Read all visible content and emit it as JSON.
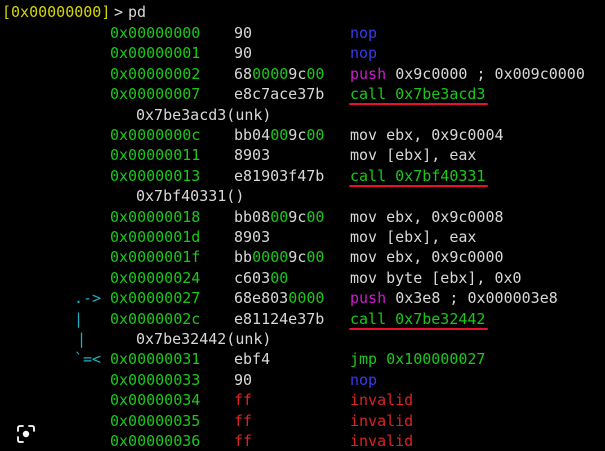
{
  "prompt": {
    "address": "[0x00000000]",
    "arrow": ">",
    "command": "pd"
  },
  "colors": {
    "background": "#000000",
    "address": "#19c819",
    "text": "#d8d8d8",
    "nop": "#3a3aee",
    "push": "#d21ad2",
    "invalid": "#dd2222",
    "flow": "#19b2c8",
    "call_underline": "#e8102a"
  },
  "rows": [
    {
      "flow": "",
      "addr": "0x00000000",
      "bytes": [
        {
          "t": "90",
          "c": "w"
        }
      ],
      "instr": [
        {
          "t": "nop",
          "c": "b"
        }
      ]
    },
    {
      "flow": "",
      "addr": "0x00000001",
      "bytes": [
        {
          "t": "90",
          "c": "w"
        }
      ],
      "instr": [
        {
          "t": "nop",
          "c": "b"
        }
      ]
    },
    {
      "flow": "",
      "addr": "0x00000002",
      "bytes": [
        {
          "t": "68",
          "c": "w"
        },
        {
          "t": "00",
          "c": "g"
        },
        {
          "t": "00",
          "c": "g"
        },
        {
          "t": "9c",
          "c": "w"
        },
        {
          "t": "00",
          "c": "g"
        }
      ],
      "instr": [
        {
          "t": "push",
          "c": "m"
        },
        {
          "t": " 0x9c0000 ; 0x009c0000",
          "c": "w"
        }
      ]
    },
    {
      "flow": "",
      "addr": "0x00000007",
      "bytes": [
        {
          "t": "e8c7ace37b",
          "c": "w"
        }
      ],
      "instr": [
        {
          "t": "call 0x7be3acd3",
          "c": "gr"
        }
      ],
      "underline": true
    },
    {
      "comment": "0x7be3acd3(unk)"
    },
    {
      "flow": "",
      "addr": "0x0000000c",
      "bytes": [
        {
          "t": "bb04",
          "c": "w"
        },
        {
          "t": "00",
          "c": "g"
        },
        {
          "t": "9c",
          "c": "w"
        },
        {
          "t": "00",
          "c": "g"
        }
      ],
      "instr": [
        {
          "t": "mov ebx, 0x9c0004",
          "c": "w"
        }
      ]
    },
    {
      "flow": "",
      "addr": "0x00000011",
      "bytes": [
        {
          "t": "8903",
          "c": "w"
        }
      ],
      "instr": [
        {
          "t": "mov [ebx], eax",
          "c": "w"
        }
      ]
    },
    {
      "flow": "",
      "addr": "0x00000013",
      "bytes": [
        {
          "t": "e81903f47b",
          "c": "w"
        }
      ],
      "instr": [
        {
          "t": "call 0x7bf40331",
          "c": "gr"
        }
      ],
      "underline": true
    },
    {
      "comment": "0x7bf40331()"
    },
    {
      "flow": "",
      "addr": "0x00000018",
      "bytes": [
        {
          "t": "bb08",
          "c": "w"
        },
        {
          "t": "00",
          "c": "g"
        },
        {
          "t": "9c",
          "c": "w"
        },
        {
          "t": "00",
          "c": "g"
        }
      ],
      "instr": [
        {
          "t": "mov ebx, 0x9c0008",
          "c": "w"
        }
      ]
    },
    {
      "flow": "",
      "addr": "0x0000001d",
      "bytes": [
        {
          "t": "8903",
          "c": "w"
        }
      ],
      "instr": [
        {
          "t": "mov [ebx], eax",
          "c": "w"
        }
      ]
    },
    {
      "flow": "",
      "addr": "0x0000001f",
      "bytes": [
        {
          "t": "bb",
          "c": "w"
        },
        {
          "t": "00",
          "c": "g"
        },
        {
          "t": "00",
          "c": "g"
        },
        {
          "t": "9c",
          "c": "w"
        },
        {
          "t": "00",
          "c": "g"
        }
      ],
      "instr": [
        {
          "t": "mov ebx, 0x9c0000",
          "c": "w"
        }
      ]
    },
    {
      "flow": "",
      "addr": "0x00000024",
      "bytes": [
        {
          "t": "c603",
          "c": "w"
        },
        {
          "t": "00",
          "c": "g"
        }
      ],
      "instr": [
        {
          "t": "mov byte [ebx], 0x0",
          "c": "w"
        }
      ]
    },
    {
      "flow": ".->",
      "addr": "0x00000027",
      "bytes": [
        {
          "t": "68e803",
          "c": "w"
        },
        {
          "t": "0000",
          "c": "g"
        }
      ],
      "instr": [
        {
          "t": "push",
          "c": "m"
        },
        {
          "t": " 0x3e8 ; 0x000003e8",
          "c": "w"
        }
      ]
    },
    {
      "flow": "|",
      "addr": "0x0000002c",
      "bytes": [
        {
          "t": "e81124e37b",
          "c": "w"
        }
      ],
      "instr": [
        {
          "t": "call 0x7be32442",
          "c": "gr"
        }
      ],
      "underline": true
    },
    {
      "comment": "0x7be32442(unk)",
      "flow": "|"
    },
    {
      "flow": "`=<",
      "addr": "0x00000031",
      "bytes": [
        {
          "t": "ebf4",
          "c": "w"
        }
      ],
      "instr": [
        {
          "t": "jmp 0x100000027",
          "c": "g"
        }
      ]
    },
    {
      "flow": "",
      "addr": "0x00000033",
      "bytes": [
        {
          "t": "90",
          "c": "w"
        }
      ],
      "instr": [
        {
          "t": "nop",
          "c": "b"
        }
      ]
    },
    {
      "flow": "",
      "addr": "0x00000034",
      "bytes": [
        {
          "t": "ff",
          "c": "r"
        }
      ],
      "instr": [
        {
          "t": "invalid",
          "c": "r"
        }
      ]
    },
    {
      "flow": "",
      "addr": "0x00000035",
      "bytes": [
        {
          "t": "ff",
          "c": "r"
        }
      ],
      "instr": [
        {
          "t": "invalid",
          "c": "r"
        }
      ]
    },
    {
      "flow": "",
      "addr": "0x00000036",
      "bytes": [
        {
          "t": "ff",
          "c": "r"
        }
      ],
      "instr": [
        {
          "t": "invalid",
          "c": "r"
        }
      ]
    }
  ],
  "scan_icon": "lens-scan-icon"
}
